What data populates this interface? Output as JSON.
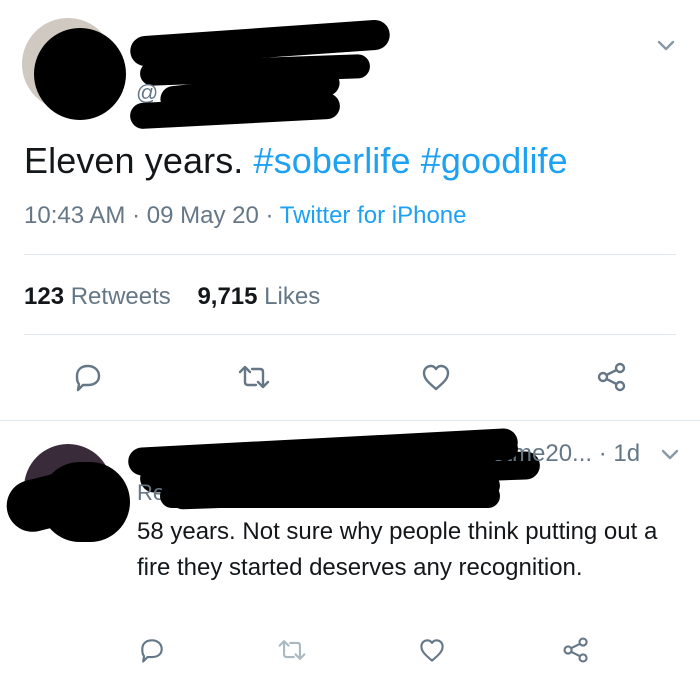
{
  "tweet": {
    "text_plain": "Eleven years.",
    "hashtag1": "#soberlife",
    "hashtag2": "#goodlife",
    "time": "10:43 AM",
    "sep1": "·",
    "date": "09 May 20",
    "sep2": "·",
    "client": "Twitter for iPhone",
    "retweets_count": "123",
    "retweets_label": "Retweets",
    "likes_count": "9,715",
    "likes_label": "Likes",
    "handle_partial": "@"
  },
  "reply": {
    "handle_tail": "otme20...",
    "time_sep": "·",
    "time": "1d",
    "replying_partial": "Re",
    "text": "58 years. Not sure why people think putting out a fire they started deserves any recognition."
  },
  "icons": [
    "chevron-down-icon",
    "reply-icon",
    "retweet-icon",
    "like-icon",
    "share-icon"
  ],
  "colors": {
    "accent": "#1da1f2",
    "muted": "#657786",
    "text": "#14171a",
    "divider": "#e1e8ed"
  }
}
